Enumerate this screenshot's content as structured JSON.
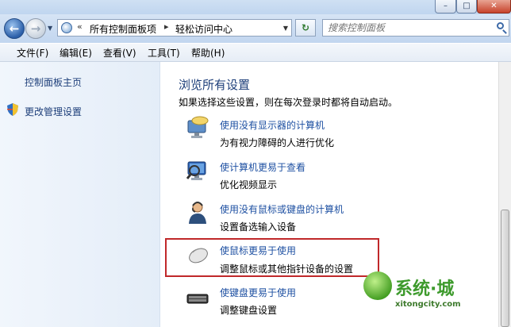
{
  "window": {
    "buttons": {
      "minimize": "–",
      "maximize": "□",
      "close": "✕"
    }
  },
  "navbar": {
    "back_icon": "back-arrow-icon",
    "forward_icon": "forward-arrow-icon",
    "address": {
      "prefix": "«",
      "crumbs": [
        "所有控制面板项",
        "轻松访问中心"
      ],
      "separator": "▸"
    },
    "refresh_icon": "refresh-icon",
    "search": {
      "placeholder": "搜索控制面板"
    }
  },
  "menubar": {
    "items": [
      "文件(F)",
      "编辑(E)",
      "查看(V)",
      "工具(T)",
      "帮助(H)"
    ]
  },
  "sidebar": {
    "links": [
      "控制面板主页",
      "更改管理设置"
    ]
  },
  "main": {
    "heading": "浏览所有设置",
    "subheading": "如果选择这些设置，则在每次登录时都将自动启动。",
    "items": [
      {
        "icon": "display-speech-icon",
        "link": "使用没有显示器的计算机",
        "desc": "为有视力障碍的人进行优化"
      },
      {
        "icon": "magnifier-monitor-icon",
        "link": "使计算机更易于查看",
        "desc": "优化视频显示"
      },
      {
        "icon": "person-headset-icon",
        "link": "使用没有鼠标或键盘的计算机",
        "desc": "设置备选输入设备"
      },
      {
        "icon": "mouse-icon",
        "link": "使鼠标更易于使用",
        "desc": "调整鼠标或其他指针设备的设置"
      },
      {
        "icon": "keyboard-icon",
        "link": "使键盘更易于使用",
        "desc": "调整键盘设置"
      }
    ]
  },
  "watermark": {
    "title": "系统·城",
    "url": "xitongcity.com"
  },
  "colors": {
    "link": "#1e50a2",
    "heading": "#1e3f7a",
    "highlight_border": "#c0282a"
  }
}
